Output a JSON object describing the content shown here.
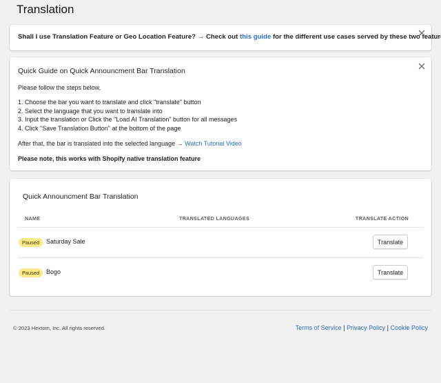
{
  "page": {
    "title": "Translation"
  },
  "banner": {
    "text_before": "Shall I use Translation Feature or Geo Location Feature? → Check out",
    "link_text": "this guide",
    "text_after": "for the different use cases served by these two features."
  },
  "guide": {
    "title": "Quick Guide on Quick Announcment Bar Translation",
    "intro": "Please follow the steps below,",
    "steps": [
      "1. Choose the bar you want to translate and click \"translate\" button",
      "2. Select the language that you want to translate into",
      "3. Input the translation or Click the \"Load AI Translation\" button for all messages",
      "4. Click \"Save Translation Button\" at the bottom of the page"
    ],
    "after_text": "After that, the bar is translated into the selected language →",
    "tutorial_link": "Watch Tutorial Video",
    "note": "Please note, this works with Shopify native translation feature"
  },
  "table": {
    "title": "Quick Announcment Bar Translation",
    "columns": [
      "NAME",
      "TRANSLATED LANGUAGES",
      "TRANSLATE ACTION"
    ],
    "rows": [
      {
        "status": "Paused",
        "name": "Saturday Sale",
        "languages": "",
        "action": "Translate"
      },
      {
        "status": "Paused",
        "name": "Bogo",
        "languages": "",
        "action": "Translate"
      }
    ]
  },
  "footer": {
    "copyright": "© 2023 Hextom, Inc. All rights reserved.",
    "links": [
      "Terms of Service",
      "Privacy Policy",
      "Cookie Policy"
    ],
    "separator": "|"
  },
  "colors": {
    "link": "#2c6ecb",
    "badge_paused": "#ffea8a",
    "background": "#f1f1f1"
  }
}
